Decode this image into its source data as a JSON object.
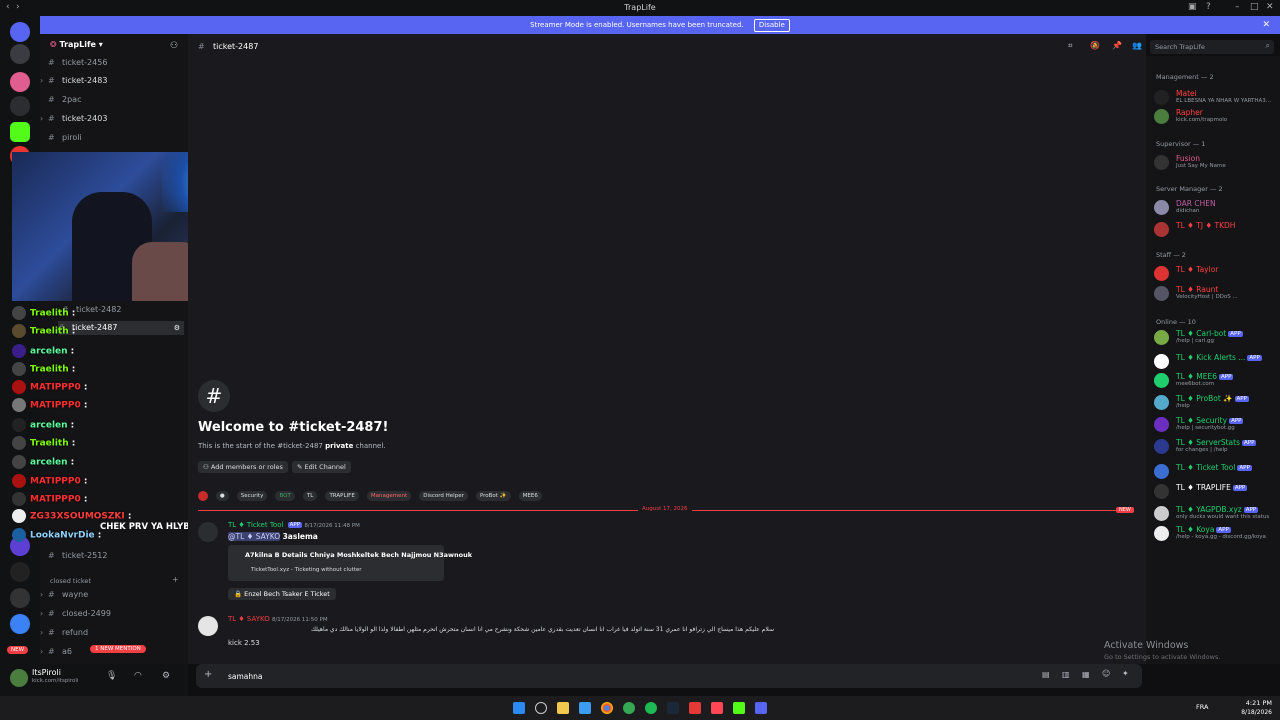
{
  "window": {
    "title": "TrapLife"
  },
  "streamer_banner": {
    "text": "Streamer Mode is enabled. Usernames have been truncated.",
    "button": "Disable"
  },
  "server": {
    "name": "TrapLife"
  },
  "channels_top": [
    "ticket-2456",
    "ticket-2483",
    "2pac",
    "ticket-2403",
    "piroli"
  ],
  "channels_overlay": [
    "ticket-2482",
    "ticket-2487"
  ],
  "channels_bottom": [
    "ticket-2512"
  ],
  "category_closed": "closed ticket",
  "channels_closed": [
    "wayne",
    "closed-2499",
    "refund",
    "a6"
  ],
  "mention_badge": "1 NEW MENTION",
  "new_badge": "NEW",
  "user": {
    "name": "ItsPiroli",
    "status": "kick.com/itspiroli"
  },
  "chat_overlay": [
    {
      "name": "Traelith",
      "color": "#7cfc00"
    },
    {
      "name": "Traelith",
      "color": "#7cfc00"
    },
    {
      "name": "arcelen",
      "color": "#5bff9c"
    },
    {
      "name": "Traelith",
      "color": "#7cfc00"
    },
    {
      "name": "MATIPPP0",
      "color": "#ff2e2e"
    },
    {
      "name": "MATIPPP0",
      "color": "#ff2e2e"
    },
    {
      "name": "arcelen",
      "color": "#5bff9c"
    },
    {
      "name": "Traelith",
      "color": "#7cfc00"
    },
    {
      "name": "arcelen",
      "color": "#5bff9c"
    },
    {
      "name": "MATIPPP0",
      "color": "#ff2e2e"
    },
    {
      "name": "MATIPPP0",
      "color": "#ff2e2e"
    },
    {
      "name": "ZG33XSOUMOSZKI",
      "color": "#ff3b3b"
    },
    {
      "name": "LookaNvrDie",
      "color": "#8fd3ff"
    }
  ],
  "chat_overlay_message": "CHEK PRV YA HLYBA",
  "topbar": {
    "channel": "ticket-2487",
    "search_placeholder": "Search TrapLife"
  },
  "welcome": {
    "title": "Welcome to #ticket-2487!",
    "subtitle_pre": "This is the start of the #ticket-2487 ",
    "subtitle_bold": "private",
    "subtitle_post": " channel.",
    "add_members": "Add members or roles",
    "edit_channel": "Edit Channel"
  },
  "role_pills": [
    "Security",
    "BOT",
    "TL",
    "TRAPLIFE",
    "Management",
    "Discord Helper",
    "ProBot ✨",
    "MEE6"
  ],
  "date_divider": "August 17, 2026",
  "new_divider": "NEW",
  "messages": [
    {
      "author": "TL ♦ Ticket Tool",
      "badge": "APP",
      "time": "8/17/2026 11:48 PM",
      "mention": "@TL ♦ SAYKO",
      "text": "3aslema",
      "embed_title": "A7kilna B Details Chniya Moshkeltek Bech Najjmou N3awnouk",
      "embed_footer": "TicketTool.xyz - Ticketing without clutter",
      "button": "🔒 Enzel Bech Tsaker E Ticket"
    },
    {
      "author": "TL ♦ SAYKO",
      "time": "8/17/2026 11:50 PM",
      "text": "سلام عليكم هذا ميساج الي زترافو انا عمري 31 سنة اتولد فيا غراب انا انسان تعديت بقدري عامين شحكة  ونشرح مي انا انسان متحرش اتحرم مثلهن اطفالا ولذا الو الولايا منالك دي ماهيلك",
      "line2": "kick 2.53"
    }
  ],
  "composer": {
    "text": "samahna"
  },
  "member_groups": [
    {
      "label": "Management — 2",
      "members": [
        {
          "name": "Matei",
          "sub": "EL LBESNA YA NHAR W YARTHA3...",
          "color": "#ff4040"
        },
        {
          "name": "Rapher",
          "sub": "kick.com/trapmolo",
          "color": "#ff4040"
        }
      ]
    },
    {
      "label": "Supervisor — 1",
      "members": [
        {
          "name": "Fusion",
          "sub": "Just Say My Name",
          "color": "#e05d8f"
        }
      ]
    },
    {
      "label": "Server Manager — 2",
      "members": [
        {
          "name": "DAR CHEN",
          "sub": "didichan",
          "color": "#c05fa5"
        },
        {
          "name": "TL ♦ TJ ♦ TKDH",
          "sub": "",
          "color": "#ff4040"
        }
      ]
    },
    {
      "label": "Staff — 2",
      "members": [
        {
          "name": "TL ♦ Taylor",
          "sub": "",
          "color": "#ff4040"
        },
        {
          "name": "TL ♦ Raunt",
          "sub": "VelocityHost | DDoS ...",
          "color": "#ff4040"
        }
      ]
    },
    {
      "label": "Online — 10",
      "members": [
        {
          "name": "TL ♦ Carl-bot",
          "sub": "/help | carl.gg",
          "color": "#1fcf6e",
          "app": "APP"
        },
        {
          "name": "TL ♦ Kick Alerts ...",
          "sub": "",
          "color": "#1fcf6e",
          "app": "APP"
        },
        {
          "name": "TL ♦ MEE6",
          "sub": "mee6bot.com",
          "color": "#1fcf6e",
          "app": "APP"
        },
        {
          "name": "TL ♦ ProBot ✨",
          "sub": "/help",
          "color": "#1fcf6e",
          "app": "APP"
        },
        {
          "name": "TL ♦ Security",
          "sub": "/help | securitybot.gg",
          "color": "#1fcf6e",
          "app": "APP"
        },
        {
          "name": "TL ♦ ServerStats",
          "sub": "for changes | /help",
          "color": "#1fcf6e",
          "app": "APP"
        },
        {
          "name": "TL ♦ Ticket Tool",
          "sub": "",
          "color": "#1fcf6e",
          "app": "APP"
        },
        {
          "name": "TL ♦ TRAPLIFE",
          "sub": "",
          "color": "#ffffff",
          "app": "APP"
        },
        {
          "name": "TL ♦ YAGPDB.xyz",
          "sub": "only ducks would want this status",
          "color": "#1fcf6e",
          "app": "APP"
        },
        {
          "name": "TL ♦ Koya",
          "sub": "/help - koya.gg - discord.gg/koya",
          "color": "#1fcf6e",
          "app": "APP"
        }
      ]
    }
  ],
  "activate_windows": {
    "title": "Activate Windows",
    "sub": "Go to Settings to activate Windows."
  },
  "clock": {
    "time": "4:21 PM",
    "date": "8/18/2026",
    "lang": "FRA"
  }
}
